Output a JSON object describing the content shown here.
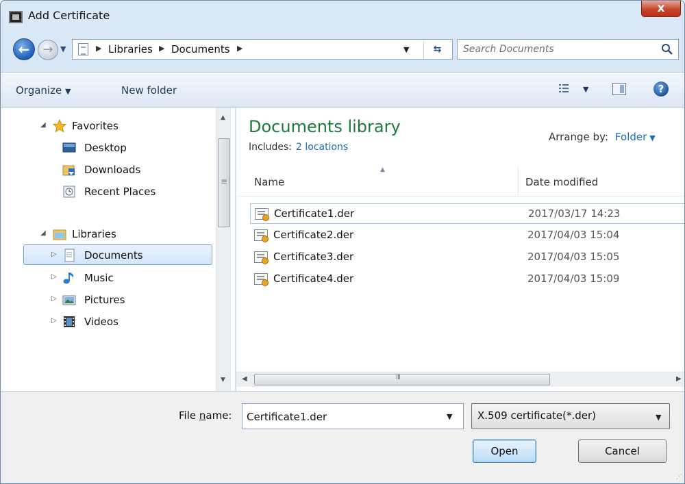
{
  "window": {
    "title": "Add Certificate",
    "close_label": "x"
  },
  "address": {
    "crumbs": [
      "Libraries",
      "Documents"
    ]
  },
  "search": {
    "placeholder": "Search Documents"
  },
  "toolbar": {
    "organize": "Organize",
    "new_folder": "New folder"
  },
  "nav": {
    "favorites": "Favorites",
    "desktop": "Desktop",
    "downloads": "Downloads",
    "recent_places": "Recent Places",
    "libraries": "Libraries",
    "documents": "Documents",
    "music": "Music",
    "pictures": "Pictures",
    "videos": "Videos"
  },
  "content": {
    "title": "Documents library",
    "includes_label": "Includes:",
    "includes_link": "2 locations",
    "arrange_label": "Arrange by:",
    "arrange_value": "Folder",
    "col_name": "Name",
    "col_date": "Date modified",
    "files": [
      {
        "name": "Certificate1.der",
        "date": "2017/03/17 14:23"
      },
      {
        "name": "Certificate2.der",
        "date": "2017/04/03 15:04"
      },
      {
        "name": "Certificate3.der",
        "date": "2017/04/03 15:05"
      },
      {
        "name": "Certificate4.der",
        "date": "2017/04/03 15:09"
      }
    ]
  },
  "bottom": {
    "file_name_label_pre": "File ",
    "file_name_label_ul": "n",
    "file_name_label_post": "ame:",
    "file_name_value": "Certificate1.der",
    "file_type": "X.509 certificate(*.der)",
    "open": "Open",
    "cancel": "Cancel"
  },
  "colors": {
    "accent_green": "#1e7a3b",
    "link_blue": "#1d6cbf",
    "selection": "#d2e6fb"
  }
}
